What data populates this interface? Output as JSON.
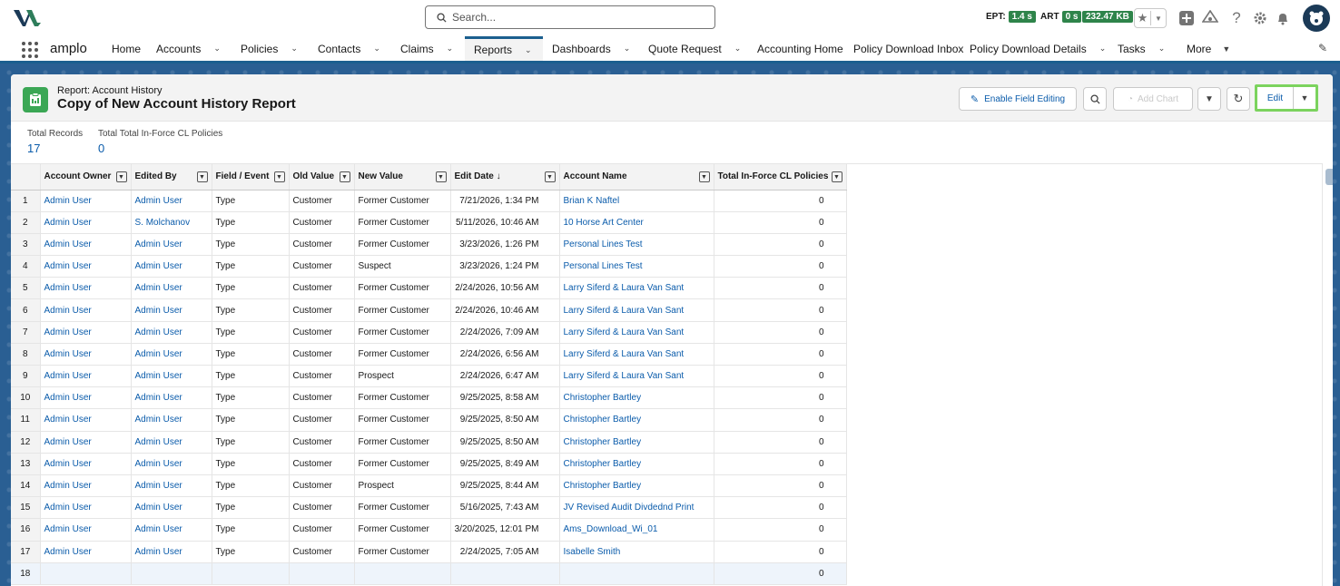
{
  "header": {
    "search_placeholder": "Search...",
    "perf": [
      {
        "label": "EPT:",
        "value": "1.4 s"
      },
      {
        "label": "ART",
        "value": "0 s"
      },
      {
        "label": "",
        "value": "232.47 KB"
      }
    ]
  },
  "nav": {
    "app_name": "amplo",
    "items": [
      {
        "label": "Home",
        "chevron": false
      },
      {
        "label": "Accounts",
        "chevron": true
      },
      {
        "label": "Policies",
        "chevron": true
      },
      {
        "label": "Contacts",
        "chevron": true
      },
      {
        "label": "Claims",
        "chevron": true
      },
      {
        "label": "Reports",
        "chevron": true,
        "active": true
      },
      {
        "label": "Dashboards",
        "chevron": true
      },
      {
        "label": "Quote Request",
        "chevron": true
      },
      {
        "label": "Accounting Home",
        "chevron": false
      },
      {
        "label": "Policy Download Inbox",
        "chevron": false
      },
      {
        "label": "Policy Download Details",
        "chevron": true
      },
      {
        "label": "Tasks",
        "chevron": true
      },
      {
        "label": "More",
        "chevron": true
      }
    ]
  },
  "report": {
    "subtitle": "Report: Account History",
    "title": "Copy of New Account History Report",
    "buttons": {
      "enable_field_editing": "Enable Field Editing",
      "add_chart": "Add Chart",
      "edit": "Edit"
    },
    "summary": [
      {
        "label": "Total Records",
        "value": "17"
      },
      {
        "label": "Total Total In-Force CL Policies",
        "value": "0"
      }
    ],
    "columns": [
      "Account Owner",
      "Edited By",
      "Field / Event",
      "Old Value",
      "New Value",
      "Edit Date",
      "Account Name",
      "Total In-Force CL Policies"
    ],
    "sort_indicator": "↓",
    "rows": [
      [
        "1",
        "Admin User",
        "Admin User",
        "Type",
        "Customer",
        "Former Customer",
        "7/21/2026, 1:34 PM",
        "Brian K Naftel",
        "0"
      ],
      [
        "2",
        "Admin User",
        "S. Molchanov",
        "Type",
        "Customer",
        "Former Customer",
        "5/11/2026, 10:46 AM",
        "10 Horse Art Center",
        "0"
      ],
      [
        "3",
        "Admin User",
        "Admin User",
        "Type",
        "Customer",
        "Former Customer",
        "3/23/2026, 1:26 PM",
        "Personal Lines Test",
        "0"
      ],
      [
        "4",
        "Admin User",
        "Admin User",
        "Type",
        "Customer",
        "Suspect",
        "3/23/2026, 1:24 PM",
        "Personal Lines Test",
        "0"
      ],
      [
        "5",
        "Admin User",
        "Admin User",
        "Type",
        "Customer",
        "Former Customer",
        "2/24/2026, 10:56 AM",
        "Larry Siferd & Laura Van Sant",
        "0"
      ],
      [
        "6",
        "Admin User",
        "Admin User",
        "Type",
        "Customer",
        "Former Customer",
        "2/24/2026, 10:46 AM",
        "Larry Siferd & Laura Van Sant",
        "0"
      ],
      [
        "7",
        "Admin User",
        "Admin User",
        "Type",
        "Customer",
        "Former Customer",
        "2/24/2026, 7:09 AM",
        "Larry Siferd & Laura Van Sant",
        "0"
      ],
      [
        "8",
        "Admin User",
        "Admin User",
        "Type",
        "Customer",
        "Former Customer",
        "2/24/2026, 6:56 AM",
        "Larry Siferd & Laura Van Sant",
        "0"
      ],
      [
        "9",
        "Admin User",
        "Admin User",
        "Type",
        "Customer",
        "Prospect",
        "2/24/2026, 6:47 AM",
        "Larry Siferd & Laura Van Sant",
        "0"
      ],
      [
        "10",
        "Admin User",
        "Admin User",
        "Type",
        "Customer",
        "Former Customer",
        "9/25/2025, 8:58 AM",
        "Christopher Bartley",
        "0"
      ],
      [
        "11",
        "Admin User",
        "Admin User",
        "Type",
        "Customer",
        "Former Customer",
        "9/25/2025, 8:50 AM",
        "Christopher Bartley",
        "0"
      ],
      [
        "12",
        "Admin User",
        "Admin User",
        "Type",
        "Customer",
        "Former Customer",
        "9/25/2025, 8:50 AM",
        "Christopher Bartley",
        "0"
      ],
      [
        "13",
        "Admin User",
        "Admin User",
        "Type",
        "Customer",
        "Former Customer",
        "9/25/2025, 8:49 AM",
        "Christopher Bartley",
        "0"
      ],
      [
        "14",
        "Admin User",
        "Admin User",
        "Type",
        "Customer",
        "Prospect",
        "9/25/2025, 8:44 AM",
        "Christopher Bartley",
        "0"
      ],
      [
        "15",
        "Admin User",
        "Admin User",
        "Type",
        "Customer",
        "Former Customer",
        "5/16/2025, 7:43 AM",
        "JV Revised Audit Divdednd Print",
        "0"
      ],
      [
        "16",
        "Admin User",
        "Admin User",
        "Type",
        "Customer",
        "Former Customer",
        "3/20/2025, 12:01 PM",
        "Ams_Download_Wi_01",
        "0"
      ],
      [
        "17",
        "Admin User",
        "Admin User",
        "Type",
        "Customer",
        "Former Customer",
        "2/24/2025, 7:05 AM",
        "Isabelle Smith",
        "0"
      ]
    ],
    "total_row": {
      "row_number": "18",
      "value": "0"
    }
  }
}
